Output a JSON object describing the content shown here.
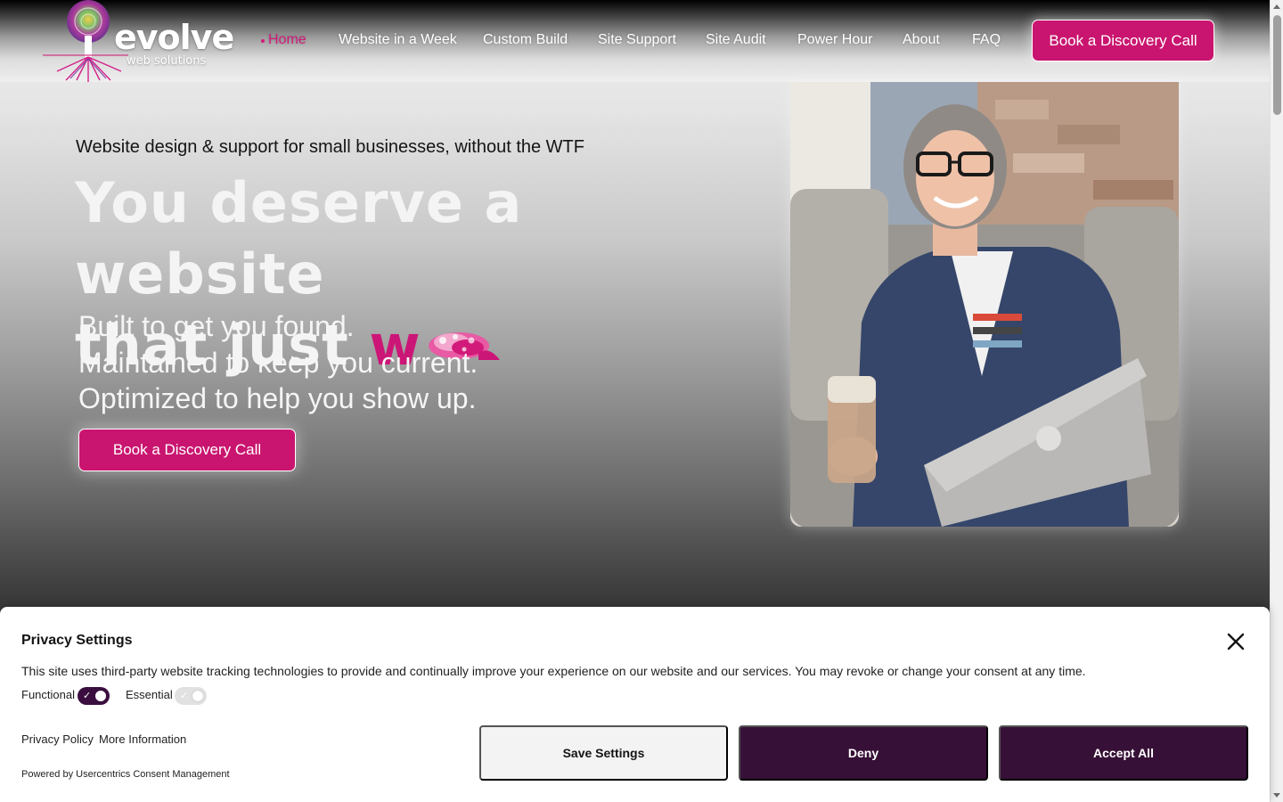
{
  "brand": {
    "name": "evolve",
    "tagline": "web solutions",
    "accent_color": "#c9156f",
    "icon": "tree-logo-icon"
  },
  "nav": {
    "items": [
      {
        "label": "Home",
        "active": true
      },
      {
        "label": "Website in a Week"
      },
      {
        "label": "Custom Build"
      },
      {
        "label": "Site Support"
      },
      {
        "label": "Site Audit"
      },
      {
        "label": "Power Hour"
      },
      {
        "label": "About"
      },
      {
        "label": "FAQ"
      }
    ],
    "cta_label": "Book a Discovery Call"
  },
  "hero": {
    "tagline": "Website design & support for small businesses, without the WTF",
    "headline_line1": "You deserve a website",
    "headline_line2_start": "that just",
    "headline_accent": "w",
    "subheadlines": [
      "Built to get you found.",
      "Maintained to keep you current.",
      "Optimized to help you show up."
    ],
    "cta_label": "Book a Discovery Call",
    "photo_icon": "portrait-photo"
  },
  "privacy": {
    "title": "Privacy Settings",
    "description": "This site uses third-party website tracking technologies to provide and continually improve your experience on our website and our services. You may revoke or change your consent at any time.",
    "toggles": [
      {
        "label": "Functional",
        "state": "on"
      },
      {
        "label": "Essential",
        "state": "disabled-on"
      }
    ],
    "privacy_policy_link": "Privacy Policy",
    "more_info_link": "More Information",
    "powered_by": "Powered by Usercentrics Consent Management",
    "buttons": {
      "save": "Save Settings",
      "deny": "Deny",
      "accept": "Accept All"
    },
    "button_color": "#361036"
  }
}
